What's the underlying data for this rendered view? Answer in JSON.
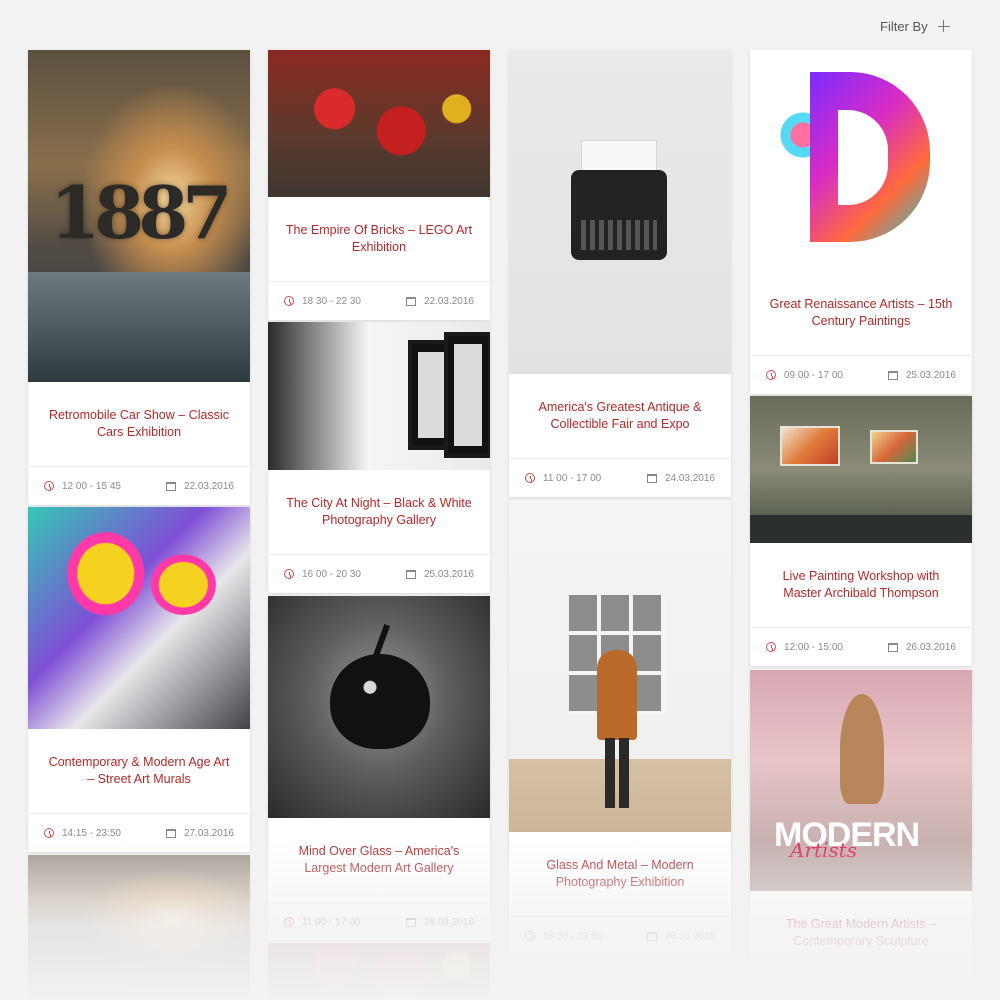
{
  "filter": {
    "label": "Filter By"
  },
  "cards": [
    {
      "id": "car",
      "title": "Retromobile Car Show – Classic Cars Exhibition",
      "time": "12 00 - 15 45",
      "date": "22.03.2016",
      "image_text": "1887"
    },
    {
      "id": "lego",
      "title": "The Empire Of Bricks – LEGO Art Exhibition",
      "time": "18 30 - 22 30",
      "date": "22.03.2016"
    },
    {
      "id": "type",
      "title": "America's Greatest Antique & Collectible Fair and Expo",
      "time": "11 00 - 17 00",
      "date": "24.03.2016"
    },
    {
      "id": "d",
      "title": "Great Renaissance Artists – 15th Century Paintings",
      "time": "09 00 - 17 00",
      "date": "25.03.2016"
    },
    {
      "id": "gallery",
      "title": "The City At Night – Black & White Photography Gallery",
      "time": "16 00 - 20 30",
      "date": "25.03.2016"
    },
    {
      "id": "graffiti",
      "title": "Contemporary & Modern Age Art – Street Art Murals",
      "time": "14:15 - 23:50",
      "date": "27.03.2016"
    },
    {
      "id": "paint",
      "title": "Live Painting Workshop with Master Archibald Thompson",
      "time": "12:00 - 15:00",
      "date": "26.03.2016"
    },
    {
      "id": "apple",
      "title": "Mind Over Glass – America's Largest Modern Art Gallery",
      "time": "11:00 - 17:00",
      "date": "28.03.2016"
    },
    {
      "id": "glass",
      "title": "Glass And Metal – Modern Photography Exhibition",
      "time": "18:30 - 23:30",
      "date": "26.03.2016"
    },
    {
      "id": "modern",
      "title": "The Great Modern Artists – Contemporary Sculpture",
      "image_text": "MODERN",
      "image_script": "Artists"
    }
  ],
  "colors": {
    "accent": "#b02a2a",
    "background": "#f2f2f3"
  }
}
